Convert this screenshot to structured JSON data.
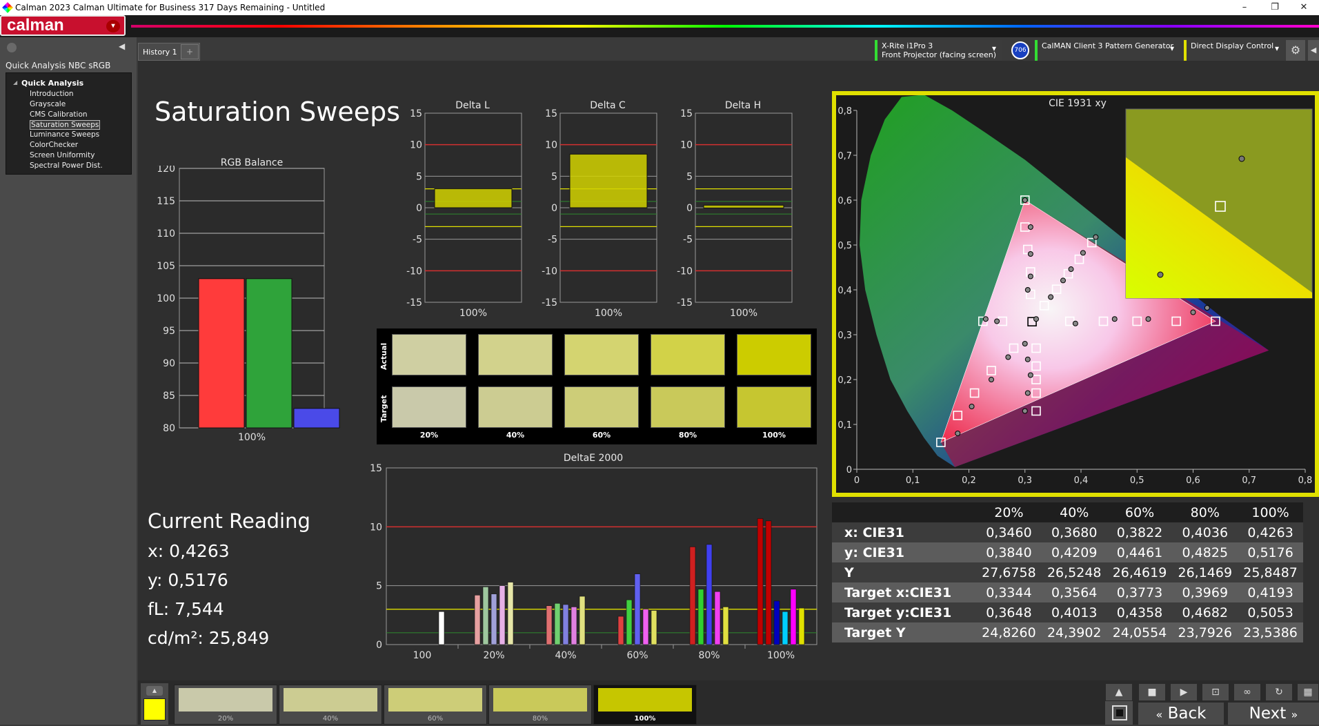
{
  "window": {
    "title": "Calman 2023 Calman Ultimate for Business 317 Days Remaining  - Untitled",
    "minimize": "–",
    "restore": "❐",
    "close": "✕"
  },
  "logo": {
    "text": "calman",
    "dropdown": "▾"
  },
  "sidebar": {
    "workflow_title": "Quick Analysis NBC sRGB",
    "root": "Quick Analysis",
    "items": [
      {
        "label": "Introduction"
      },
      {
        "label": "Grayscale"
      },
      {
        "label": "CMS Calibration"
      },
      {
        "label": "Saturation Sweeps",
        "selected": true
      },
      {
        "label": "Luminance Sweeps"
      },
      {
        "label": "ColorChecker"
      },
      {
        "label": "Screen Uniformity"
      },
      {
        "label": "Spectral Power Dist."
      }
    ]
  },
  "tabs": {
    "history": "History 1",
    "add": "+"
  },
  "devices": {
    "meter_line1": "X-Rite i1Pro 3",
    "meter_line2": "Front Projector (facing screen)",
    "meter_badge": "706",
    "pattern": "CalMAN Client 3 Pattern Generator",
    "display": "Direct Display Control"
  },
  "page_title": "Saturation Sweeps",
  "current_reading": {
    "heading": "Current Reading",
    "x": "x: 0,4263",
    "y": "y: 0,5176",
    "fl": "fL: 7,544",
    "cdm2": "cd/m²: 25,849"
  },
  "colors": {
    "target_yellow": "#d7d700",
    "red_bar": "#ff3b3b",
    "green_bar": "#2fa33a",
    "blue_bar": "#4a4ae8",
    "selection_frame": "#e0e000"
  },
  "chart_data": [
    {
      "type": "bar",
      "title": "RGB Balance",
      "categories": [
        "100%"
      ],
      "series": [
        {
          "name": "Red",
          "values": [
            103
          ]
        },
        {
          "name": "Green",
          "values": [
            103
          ]
        },
        {
          "name": "Blue",
          "values": [
            83
          ]
        }
      ],
      "ylim": [
        80,
        120
      ],
      "yticks": [
        80,
        85,
        90,
        95,
        100,
        105,
        110,
        115,
        120
      ]
    },
    {
      "type": "bar",
      "title": "Delta L",
      "categories": [
        "100%"
      ],
      "values": [
        3
      ],
      "ylim": [
        -15,
        15
      ],
      "yticks": [
        -15,
        -10,
        -5,
        0,
        5,
        10,
        15
      ]
    },
    {
      "type": "bar",
      "title": "Delta C",
      "categories": [
        "100%"
      ],
      "values": [
        8.5
      ],
      "ylim": [
        -15,
        15
      ],
      "yticks": [
        -15,
        -10,
        -5,
        0,
        5,
        10,
        15
      ]
    },
    {
      "type": "bar",
      "title": "Delta H",
      "categories": [
        "100%"
      ],
      "values": [
        0.4
      ],
      "ylim": [
        -15,
        15
      ],
      "yticks": [
        -15,
        -10,
        -5,
        0,
        5,
        10,
        15
      ]
    },
    {
      "type": "bar",
      "title": "DeltaE 2000",
      "categories": [
        "100",
        "20%",
        "40%",
        "60%",
        "80%",
        "100%"
      ],
      "groups": [
        {
          "label": "100",
          "values": [
            2.8
          ],
          "colors": [
            "#ffffff"
          ]
        },
        {
          "label": "20%",
          "values": [
            4.2,
            4.9,
            4.3,
            5.0,
            5.3
          ],
          "colors": [
            "#e6a0a0",
            "#9ec79e",
            "#a0a0d8",
            "#e6b0e6",
            "#e6e6a8"
          ]
        },
        {
          "label": "40%",
          "values": [
            3.3,
            3.5,
            3.4,
            3.2,
            4.1
          ],
          "colors": [
            "#e07070",
            "#70d070",
            "#8080e0",
            "#e080e0",
            "#e0e080"
          ]
        },
        {
          "label": "60%",
          "values": [
            2.4,
            3.8,
            6.0,
            3.0,
            2.9
          ],
          "colors": [
            "#e04040",
            "#40d040",
            "#6060f0",
            "#f060f0",
            "#e0e060"
          ]
        },
        {
          "label": "80%",
          "values": [
            8.3,
            4.7,
            8.5,
            4.5,
            3.2
          ],
          "colors": [
            "#d02020",
            "#30d030",
            "#4040f0",
            "#f040f0",
            "#e0e040"
          ]
        },
        {
          "label": "100%",
          "values": [
            10.7,
            10.5,
            3.7,
            2.8,
            4.7,
            3.1
          ],
          "colors": [
            "#c00000",
            "#c00000",
            "#0000c0",
            "#00d0ff",
            "#ff00ff",
            "#e0e000"
          ]
        }
      ],
      "ylim": [
        0,
        15
      ],
      "yticks": [
        0,
        5,
        10,
        15
      ]
    },
    {
      "type": "scatter",
      "title": "CIE 1931 xy",
      "xlim": [
        0,
        0.8
      ],
      "ylim": [
        0,
        0.8
      ],
      "xticks": [
        "0",
        "0,1",
        "0,2",
        "0,3",
        "0,4",
        "0,5",
        "0,6",
        "0,7",
        "0,8"
      ],
      "yticks": [
        "0",
        "0,1",
        "0,2",
        "0,3",
        "0,4",
        "0,5",
        "0,6",
        "0,7",
        "0,8"
      ],
      "gamut": [
        [
          0.64,
          0.33
        ],
        [
          0.3,
          0.6
        ],
        [
          0.15,
          0.06
        ]
      ],
      "white": [
        0.3127,
        0.329
      ],
      "targets": [
        [
          0.15,
          0.06
        ],
        [
          0.18,
          0.12
        ],
        [
          0.21,
          0.17
        ],
        [
          0.24,
          0.22
        ],
        [
          0.28,
          0.27
        ],
        [
          0.3,
          0.6
        ],
        [
          0.3,
          0.54
        ],
        [
          0.305,
          0.49
        ],
        [
          0.31,
          0.44
        ],
        [
          0.31,
          0.39
        ],
        [
          0.32,
          0.13
        ],
        [
          0.32,
          0.17
        ],
        [
          0.32,
          0.2
        ],
        [
          0.32,
          0.23
        ],
        [
          0.32,
          0.27
        ],
        [
          0.225,
          0.33
        ],
        [
          0.26,
          0.33
        ],
        [
          0.38,
          0.33
        ],
        [
          0.44,
          0.33
        ],
        [
          0.5,
          0.33
        ],
        [
          0.57,
          0.33
        ],
        [
          0.64,
          0.33
        ],
        [
          0.3344,
          0.3648
        ],
        [
          0.3564,
          0.4013
        ],
        [
          0.3773,
          0.4358
        ],
        [
          0.3969,
          0.4682
        ],
        [
          0.4193,
          0.5053
        ]
      ],
      "measured": [
        [
          0.18,
          0.08
        ],
        [
          0.205,
          0.14
        ],
        [
          0.24,
          0.2
        ],
        [
          0.27,
          0.25
        ],
        [
          0.3,
          0.6
        ],
        [
          0.31,
          0.54
        ],
        [
          0.31,
          0.48
        ],
        [
          0.31,
          0.43
        ],
        [
          0.305,
          0.4
        ],
        [
          0.32,
          0.335
        ],
        [
          0.3,
          0.13
        ],
        [
          0.305,
          0.17
        ],
        [
          0.31,
          0.21
        ],
        [
          0.305,
          0.245
        ],
        [
          0.3,
          0.28
        ],
        [
          0.23,
          0.335
        ],
        [
          0.25,
          0.33
        ],
        [
          0.39,
          0.325
        ],
        [
          0.46,
          0.335
        ],
        [
          0.52,
          0.335
        ],
        [
          0.6,
          0.35
        ],
        [
          0.625,
          0.36
        ],
        [
          0.346,
          0.384
        ],
        [
          0.368,
          0.4209
        ],
        [
          0.3822,
          0.4461
        ],
        [
          0.4036,
          0.4825
        ],
        [
          0.4263,
          0.5176
        ]
      ]
    }
  ],
  "swatches": {
    "row_actual": "Actual",
    "row_target": "Target",
    "columns": [
      {
        "label": "20%",
        "actual": "#cfcfa2",
        "target": "#c9c9aa"
      },
      {
        "label": "40%",
        "actual": "#d2d28c",
        "target": "#cccc92"
      },
      {
        "label": "60%",
        "actual": "#d4d470",
        "target": "#cdcd78"
      },
      {
        "label": "80%",
        "actual": "#d2d248",
        "target": "#c9c95a"
      },
      {
        "label": "100%",
        "actual": "#cccc00",
        "target": "#c6c630"
      }
    ]
  },
  "table": {
    "headers": [
      "",
      "20%",
      "40%",
      "60%",
      "80%",
      "100%"
    ],
    "rows": [
      {
        "label": "x: CIE31",
        "values": [
          "0,3460",
          "0,3680",
          "0,3822",
          "0,4036",
          "0,4263"
        ]
      },
      {
        "label": "y: CIE31",
        "values": [
          "0,3840",
          "0,4209",
          "0,4461",
          "0,4825",
          "0,5176"
        ]
      },
      {
        "label": "Y",
        "values": [
          "27,6758",
          "26,5248",
          "26,4619",
          "26,1469",
          "25,8487"
        ]
      },
      {
        "label": "Target x:CIE31",
        "values": [
          "0,3344",
          "0,3564",
          "0,3773",
          "0,3969",
          "0,4193"
        ]
      },
      {
        "label": "Target y:CIE31",
        "values": [
          "0,3648",
          "0,4013",
          "0,4358",
          "0,4682",
          "0,5053"
        ]
      },
      {
        "label": "Target Y",
        "values": [
          "24,8260",
          "24,3902",
          "24,0554",
          "23,7926",
          "23,5386"
        ]
      }
    ]
  },
  "bottom": {
    "tiles": [
      {
        "label": "20%",
        "color": "#c9c9aa"
      },
      {
        "label": "40%",
        "color": "#cccc92"
      },
      {
        "label": "60%",
        "color": "#cdcd78"
      },
      {
        "label": "80%",
        "color": "#c9c95a"
      },
      {
        "label": "100%",
        "color": "#c6c600"
      }
    ],
    "back": "Back",
    "next": "Next"
  }
}
